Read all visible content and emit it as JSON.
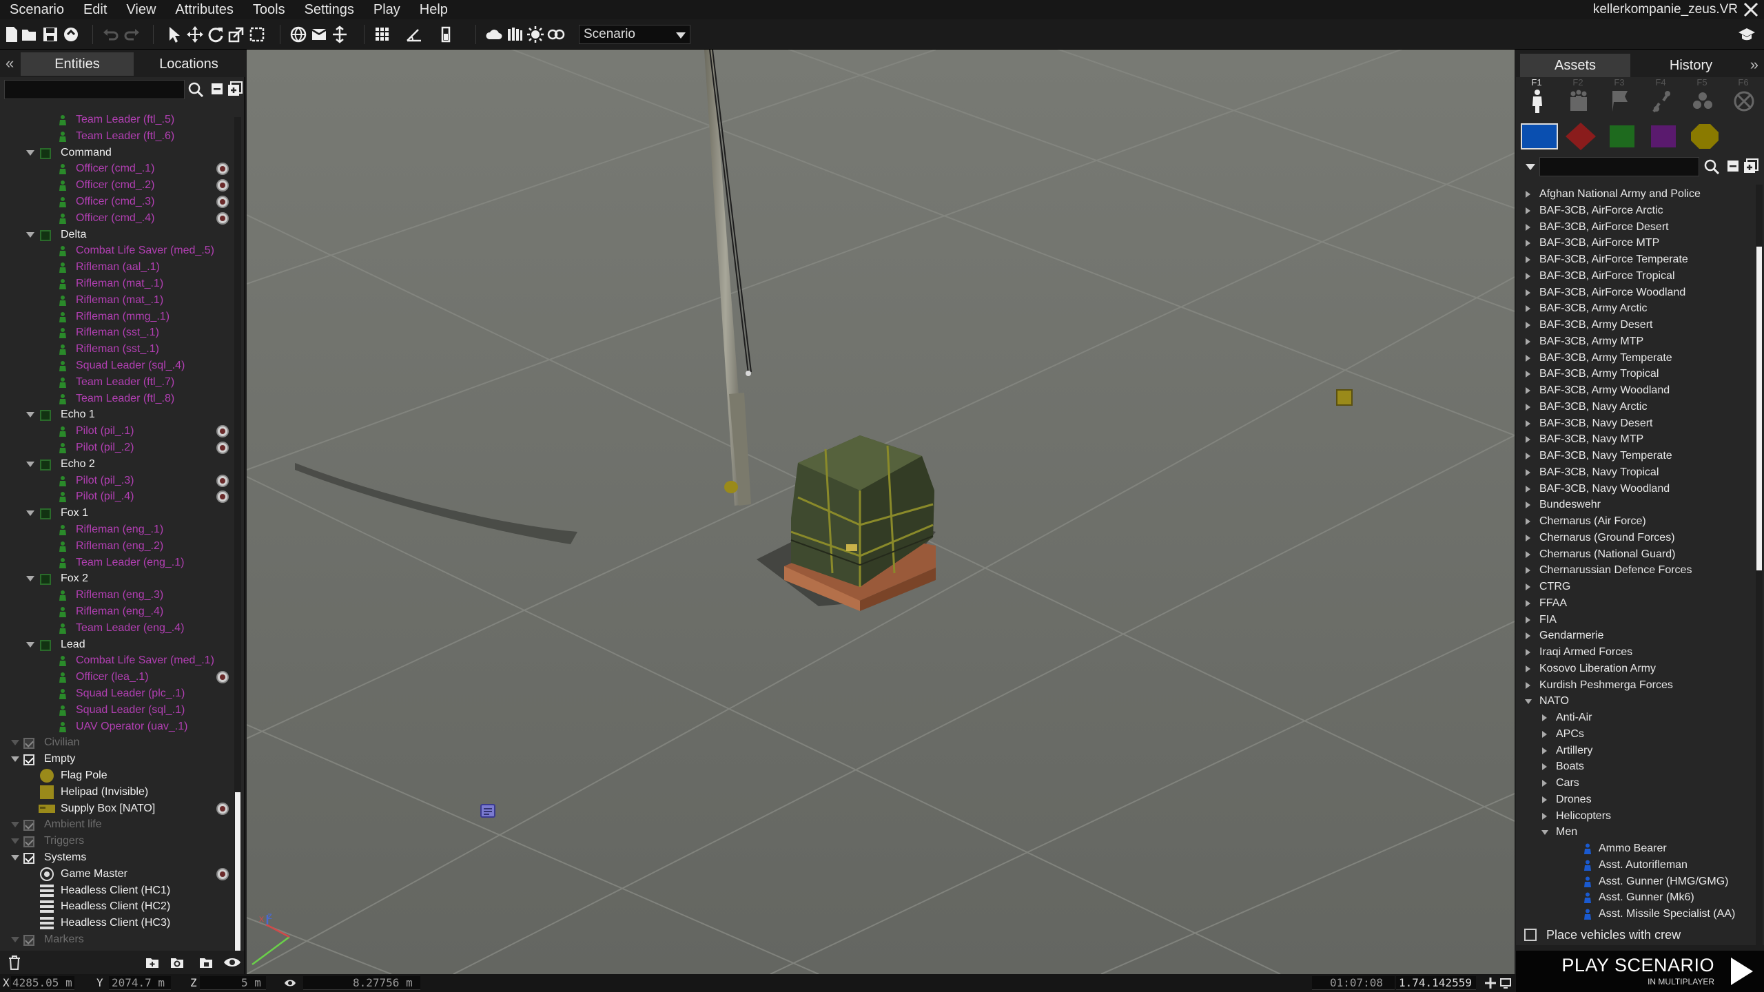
{
  "menubar": {
    "items": [
      "Scenario",
      "Edit",
      "View",
      "Attributes",
      "Tools",
      "Settings",
      "Play",
      "Help"
    ],
    "mission_title": "kellerkompanie_zeus.VR"
  },
  "toolbar": {
    "mode_select": "Scenario",
    "icons": [
      "new-file",
      "open-folder",
      "save",
      "publish",
      "undo",
      "redo",
      "select",
      "translate",
      "rotate",
      "scale",
      "area",
      "map",
      "mail",
      "vertical",
      "grid",
      "angle",
      "battery",
      "weather",
      "columns",
      "sun",
      "vision"
    ]
  },
  "left_panel": {
    "tabs": [
      "Entities",
      "Locations"
    ],
    "collapse_label": "«",
    "search_placeholder": "",
    "entities": [
      {
        "type": "unit",
        "label": "Team Leader (ftl_.5)",
        "indent": 1,
        "badge": false
      },
      {
        "type": "unit",
        "label": "Team Leader (ftl_.6)",
        "indent": 1,
        "badge": false
      },
      {
        "type": "group",
        "label": "Command"
      },
      {
        "type": "unit",
        "label": "Officer (cmd_.1)",
        "indent": 1,
        "badge": true
      },
      {
        "type": "unit",
        "label": "Officer (cmd_.2)",
        "indent": 1,
        "badge": true
      },
      {
        "type": "unit",
        "label": "Officer (cmd_.3)",
        "indent": 1,
        "badge": true
      },
      {
        "type": "unit",
        "label": "Officer (cmd_.4)",
        "indent": 1,
        "badge": true
      },
      {
        "type": "group",
        "label": "Delta"
      },
      {
        "type": "unit",
        "label": "Combat Life Saver (med_.5)",
        "indent": 1,
        "badge": false
      },
      {
        "type": "unit",
        "label": "Rifleman (aal_.1)",
        "indent": 1,
        "badge": false
      },
      {
        "type": "unit",
        "label": "Rifleman (mat_.1)",
        "indent": 1,
        "badge": false
      },
      {
        "type": "unit",
        "label": "Rifleman (mat_.1)",
        "indent": 1,
        "badge": false
      },
      {
        "type": "unit",
        "label": "Rifleman (mmg_.1)",
        "indent": 1,
        "badge": false
      },
      {
        "type": "unit",
        "label": "Rifleman (sst_.1)",
        "indent": 1,
        "badge": false
      },
      {
        "type": "unit",
        "label": "Rifleman (sst_.1)",
        "indent": 1,
        "badge": false
      },
      {
        "type": "unit",
        "label": "Squad Leader (sql_.4)",
        "indent": 1,
        "badge": false
      },
      {
        "type": "unit",
        "label": "Team Leader (ftl_.7)",
        "indent": 1,
        "badge": false
      },
      {
        "type": "unit",
        "label": "Team Leader (ftl_.8)",
        "indent": 1,
        "badge": false
      },
      {
        "type": "group",
        "label": "Echo 1"
      },
      {
        "type": "unit",
        "label": "Pilot (pil_.1)",
        "indent": 1,
        "badge": true
      },
      {
        "type": "unit",
        "label": "Pilot (pil_.2)",
        "indent": 1,
        "badge": true
      },
      {
        "type": "group",
        "label": "Echo 2"
      },
      {
        "type": "unit",
        "label": "Pilot (pil_.3)",
        "indent": 1,
        "badge": true
      },
      {
        "type": "unit",
        "label": "Pilot (pil_.4)",
        "indent": 1,
        "badge": true
      },
      {
        "type": "group",
        "label": "Fox 1"
      },
      {
        "type": "unit",
        "label": "Rifleman (eng_.1)",
        "indent": 1,
        "badge": false
      },
      {
        "type": "unit",
        "label": "Rifleman (eng_.2)",
        "indent": 1,
        "badge": false
      },
      {
        "type": "unit",
        "label": "Team Leader (eng_.1)",
        "indent": 1,
        "badge": false
      },
      {
        "type": "group",
        "label": "Fox 2"
      },
      {
        "type": "unit",
        "label": "Rifleman (eng_.3)",
        "indent": 1,
        "badge": false
      },
      {
        "type": "unit",
        "label": "Rifleman (eng_.4)",
        "indent": 1,
        "badge": false
      },
      {
        "type": "unit",
        "label": "Team Leader (eng_.4)",
        "indent": 1,
        "badge": false
      },
      {
        "type": "group",
        "label": "Lead"
      },
      {
        "type": "unit",
        "label": "Combat Life Saver (med_.1)",
        "indent": 1,
        "badge": false
      },
      {
        "type": "unit",
        "label": "Officer (lea_.1)",
        "indent": 1,
        "badge": true
      },
      {
        "type": "unit",
        "label": "Squad Leader (plc_.1)",
        "indent": 1,
        "badge": false
      },
      {
        "type": "unit",
        "label": "Squad Leader (sql_.1)",
        "indent": 1,
        "badge": false
      },
      {
        "type": "unit",
        "label": "UAV Operator (uav_.1)",
        "indent": 1,
        "badge": false
      },
      {
        "type": "category-dim",
        "label": "Civilian"
      },
      {
        "type": "category",
        "label": "Empty"
      },
      {
        "type": "object",
        "label": "Flag Pole",
        "icon": "flag-pole-icon",
        "badge": false
      },
      {
        "type": "object",
        "label": "Helipad (Invisible)",
        "icon": "helipad-icon",
        "badge": false
      },
      {
        "type": "object",
        "label": "Supply Box [NATO]",
        "icon": "supply-box-icon",
        "badge": true
      },
      {
        "type": "category-dim",
        "label": "Ambient life"
      },
      {
        "type": "category-dim",
        "label": "Triggers"
      },
      {
        "type": "category",
        "label": "Systems"
      },
      {
        "type": "object",
        "label": "Game Master",
        "icon": "game-master-icon",
        "badge": true
      },
      {
        "type": "object",
        "label": "Headless Client (HC1)",
        "icon": "headless-client-icon",
        "badge": false
      },
      {
        "type": "object",
        "label": "Headless Client (HC2)",
        "icon": "headless-client-icon",
        "badge": false
      },
      {
        "type": "object",
        "label": "Headless Client (HC3)",
        "icon": "headless-client-icon",
        "badge": false
      },
      {
        "type": "category-dim",
        "label": "Markers"
      }
    ]
  },
  "right_panel": {
    "tabs": [
      "Assets",
      "History"
    ],
    "expand_label": "»",
    "function_keys": [
      "F1",
      "F2",
      "F3",
      "F4",
      "F5",
      "F6"
    ],
    "side_colors": {
      "blufor": "#0a4fb0",
      "opfor": "#8a1c1c",
      "independent": "#1e6a1e",
      "civilian": "#5a1a6e",
      "empty": "#8a7a00"
    },
    "search_placeholder": "",
    "factions": [
      {
        "label": "Afghan National Army and Police",
        "level": 0,
        "state": "collapsed"
      },
      {
        "label": "BAF-3CB, AirForce Arctic",
        "level": 0,
        "state": "collapsed"
      },
      {
        "label": "BAF-3CB, AirForce Desert",
        "level": 0,
        "state": "collapsed"
      },
      {
        "label": "BAF-3CB, AirForce MTP",
        "level": 0,
        "state": "collapsed"
      },
      {
        "label": "BAF-3CB, AirForce Temperate",
        "level": 0,
        "state": "collapsed"
      },
      {
        "label": "BAF-3CB, AirForce Tropical",
        "level": 0,
        "state": "collapsed"
      },
      {
        "label": "BAF-3CB, AirForce Woodland",
        "level": 0,
        "state": "collapsed"
      },
      {
        "label": "BAF-3CB, Army Arctic",
        "level": 0,
        "state": "collapsed"
      },
      {
        "label": "BAF-3CB, Army Desert",
        "level": 0,
        "state": "collapsed"
      },
      {
        "label": "BAF-3CB, Army MTP",
        "level": 0,
        "state": "collapsed"
      },
      {
        "label": "BAF-3CB, Army Temperate",
        "level": 0,
        "state": "collapsed"
      },
      {
        "label": "BAF-3CB, Army Tropical",
        "level": 0,
        "state": "collapsed"
      },
      {
        "label": "BAF-3CB, Army Woodland",
        "level": 0,
        "state": "collapsed"
      },
      {
        "label": "BAF-3CB, Navy Arctic",
        "level": 0,
        "state": "collapsed"
      },
      {
        "label": "BAF-3CB, Navy Desert",
        "level": 0,
        "state": "collapsed"
      },
      {
        "label": "BAF-3CB, Navy MTP",
        "level": 0,
        "state": "collapsed"
      },
      {
        "label": "BAF-3CB, Navy Temperate",
        "level": 0,
        "state": "collapsed"
      },
      {
        "label": "BAF-3CB, Navy Tropical",
        "level": 0,
        "state": "collapsed"
      },
      {
        "label": "BAF-3CB, Navy Woodland",
        "level": 0,
        "state": "collapsed"
      },
      {
        "label": "Bundeswehr",
        "level": 0,
        "state": "collapsed"
      },
      {
        "label": "Chernarus (Air Force)",
        "level": 0,
        "state": "collapsed"
      },
      {
        "label": "Chernarus (Ground Forces)",
        "level": 0,
        "state": "collapsed"
      },
      {
        "label": "Chernarus (National Guard)",
        "level": 0,
        "state": "collapsed"
      },
      {
        "label": "Chernarussian Defence Forces",
        "level": 0,
        "state": "collapsed"
      },
      {
        "label": "CTRG",
        "level": 0,
        "state": "collapsed"
      },
      {
        "label": "FFAA",
        "level": 0,
        "state": "collapsed"
      },
      {
        "label": "FIA",
        "level": 0,
        "state": "collapsed"
      },
      {
        "label": "Gendarmerie",
        "level": 0,
        "state": "collapsed"
      },
      {
        "label": "Iraqi Armed Forces",
        "level": 0,
        "state": "collapsed"
      },
      {
        "label": "Kosovo Liberation Army",
        "level": 0,
        "state": "collapsed"
      },
      {
        "label": "Kurdish Peshmerga Forces",
        "level": 0,
        "state": "collapsed"
      },
      {
        "label": "NATO",
        "level": 0,
        "state": "expanded"
      },
      {
        "label": "Anti-Air",
        "level": 1,
        "state": "collapsed"
      },
      {
        "label": "APCs",
        "level": 1,
        "state": "collapsed"
      },
      {
        "label": "Artillery",
        "level": 1,
        "state": "collapsed"
      },
      {
        "label": "Boats",
        "level": 1,
        "state": "collapsed"
      },
      {
        "label": "Cars",
        "level": 1,
        "state": "collapsed"
      },
      {
        "label": "Drones",
        "level": 1,
        "state": "collapsed"
      },
      {
        "label": "Helicopters",
        "level": 1,
        "state": "collapsed"
      },
      {
        "label": "Men",
        "level": 1,
        "state": "expanded"
      },
      {
        "label": "Ammo Bearer",
        "level": 2,
        "state": "leaf"
      },
      {
        "label": "Asst. Autorifleman",
        "level": 2,
        "state": "leaf"
      },
      {
        "label": "Asst. Gunner (HMG/GMG)",
        "level": 2,
        "state": "leaf"
      },
      {
        "label": "Asst. Gunner (Mk6)",
        "level": 2,
        "state": "leaf"
      },
      {
        "label": "Asst. Missile Specialist (AA)",
        "level": 2,
        "state": "leaf"
      }
    ],
    "place_vehicles_label": "Place vehicles with crew",
    "place_vehicles_checked": false
  },
  "play_button": {
    "label": "PLAY SCENARIO",
    "sublabel": "IN MULTIPLAYER"
  },
  "statusbar": {
    "x_label": "X",
    "x_value": "4285.05 m",
    "y_label": "Y",
    "y_value": "2074.7 m",
    "z_label": "Z",
    "z_value": "5 m",
    "view_value": "8.27756 m",
    "time": "01:07:08",
    "version": "1.74.142559"
  }
}
